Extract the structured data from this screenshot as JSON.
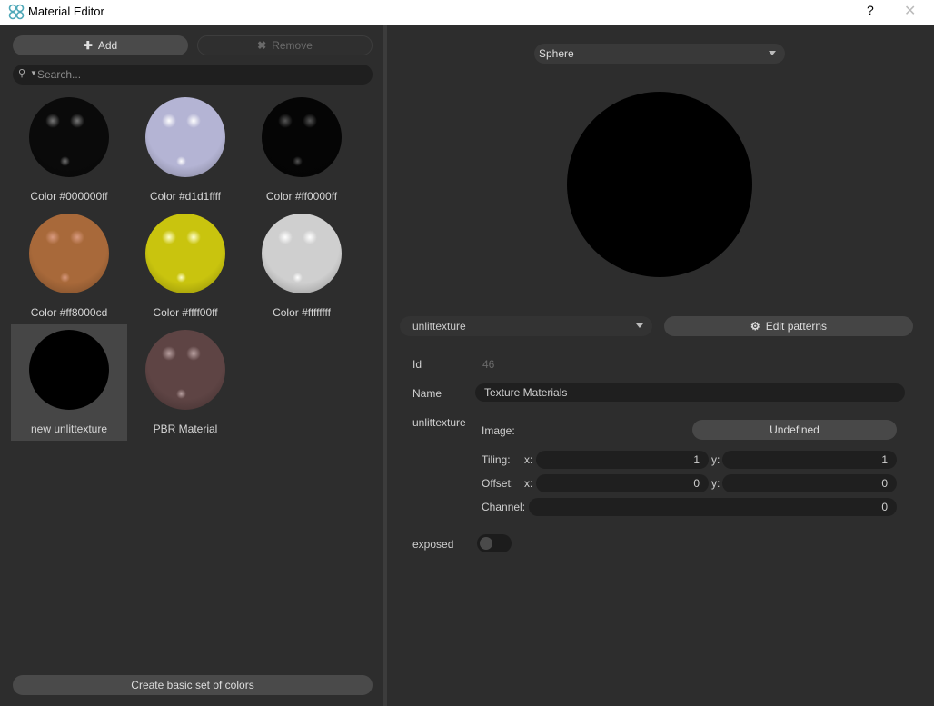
{
  "window": {
    "title": "Material Editor",
    "help_label": "?",
    "close_label": "✕"
  },
  "left": {
    "add_label": "Add",
    "add_icon": "plus-icon",
    "remove_label": "Remove",
    "remove_icon": "x-icon",
    "search_placeholder": "Search...",
    "materials": [
      {
        "label": "Color #000000ff",
        "base": "#0a0a0a",
        "spec": "#777777",
        "selected": false
      },
      {
        "label": "Color #d1d1ffff",
        "base": "#b4b4d4",
        "spec": "#ffffff",
        "selected": false
      },
      {
        "label": "Color #ff0000ff",
        "base": "#050505",
        "spec": "#555555",
        "selected": false
      },
      {
        "label": "Color #ff8000cd",
        "base": "#a8693a",
        "spec": "#d99a80",
        "selected": false
      },
      {
        "label": "Color #ffff00ff",
        "base": "#c9c40e",
        "spec": "#ffffcc",
        "selected": false
      },
      {
        "label": "Color #ffffffff",
        "base": "#cfcfcf",
        "spec": "#ffffff",
        "selected": false
      },
      {
        "label": "new unlittexture",
        "base": "#000000",
        "spec": null,
        "selected": true
      },
      {
        "label": "PBR Material",
        "base": "#5e4444",
        "spec": "#b8a0a0",
        "selected": false
      }
    ],
    "create_label": "Create basic set of colors"
  },
  "right": {
    "shape_select": "Sphere",
    "material_type": "unlittexture",
    "edit_patterns_label": "Edit patterns",
    "id_label": "Id",
    "id_value": "46",
    "name_label": "Name",
    "name_value": "Texture Materials",
    "section_label": "unlittexture",
    "image_label": "Image:",
    "image_value": "Undefined",
    "tiling_label": "Tiling:",
    "tiling_x": "1",
    "tiling_y": "1",
    "offset_label": "Offset:",
    "offset_x": "0",
    "offset_y": "0",
    "channel_label": "Channel:",
    "channel_value": "0",
    "x_label": "x:",
    "y_label": "y:",
    "exposed_label": "exposed",
    "exposed_on": false
  }
}
